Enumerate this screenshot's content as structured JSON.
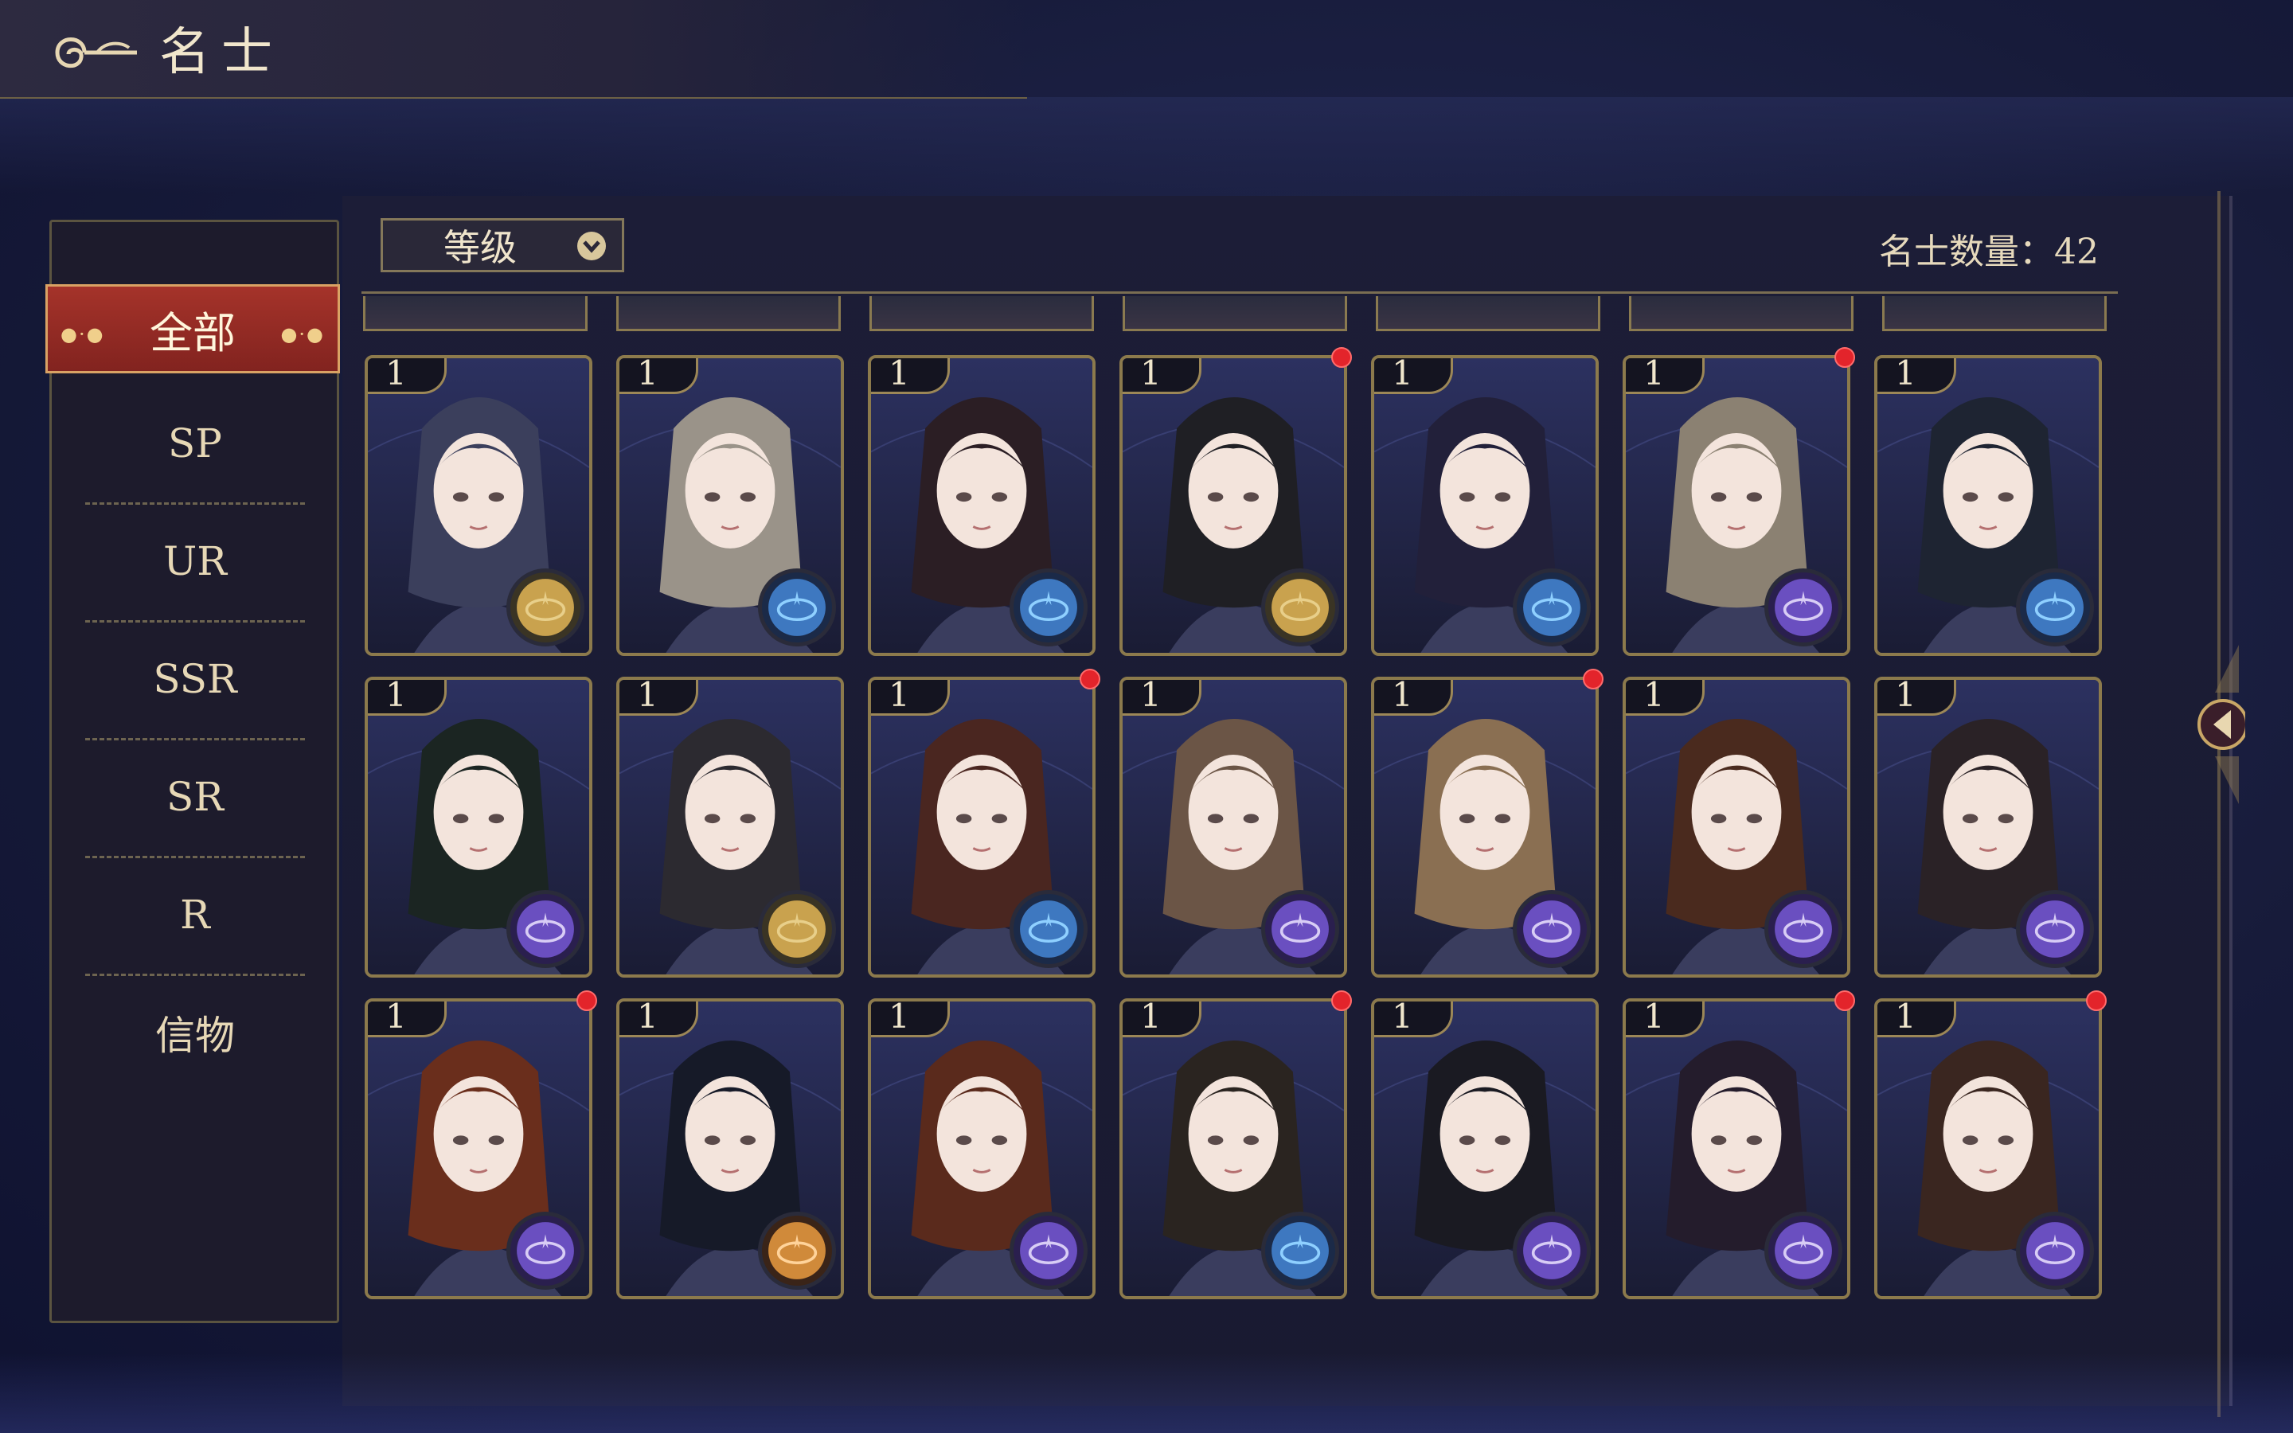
{
  "header": {
    "title": "名士"
  },
  "toolbar": {
    "sort_label": "等级",
    "count_label": "名士数量：42"
  },
  "sidebar": {
    "active": "全部",
    "items": [
      "SP",
      "UR",
      "SSR",
      "SR",
      "R",
      "信物"
    ]
  },
  "colors": {
    "accent_red": "#a5332a",
    "gold_border": "#8c7a4c",
    "notif_red": "#e3242b"
  },
  "cards": [
    {
      "level": "1",
      "hair": "#3b3f5c",
      "emblem": "gold",
      "dot": false
    },
    {
      "level": "1",
      "hair": "#9a9389",
      "emblem": "blue",
      "dot": false
    },
    {
      "level": "1",
      "hair": "#2b1e24",
      "emblem": "blue",
      "dot": false
    },
    {
      "level": "1",
      "hair": "#1f1f24",
      "emblem": "gold",
      "dot": true
    },
    {
      "level": "1",
      "hair": "#22203a",
      "emblem": "blue",
      "dot": false
    },
    {
      "level": "1",
      "hair": "#8b8172",
      "emblem": "purple",
      "dot": true
    },
    {
      "level": "1",
      "hair": "#1e2432",
      "emblem": "blue",
      "dot": false
    },
    {
      "level": "1",
      "hair": "#1b2522",
      "emblem": "purple",
      "dot": false
    },
    {
      "level": "1",
      "hair": "#2c2a30",
      "emblem": "gold",
      "dot": false
    },
    {
      "level": "1",
      "hair": "#4a2620",
      "emblem": "blue",
      "dot": true
    },
    {
      "level": "1",
      "hair": "#6b5546",
      "emblem": "purple",
      "dot": false
    },
    {
      "level": "1",
      "hair": "#8a6f52",
      "emblem": "purple",
      "dot": true
    },
    {
      "level": "1",
      "hair": "#4a2a1e",
      "emblem": "purple",
      "dot": false
    },
    {
      "level": "1",
      "hair": "#2a2226",
      "emblem": "purple",
      "dot": false
    },
    {
      "level": "1",
      "hair": "#6a2e1c",
      "emblem": "purple",
      "dot": true
    },
    {
      "level": "1",
      "hair": "#161a28",
      "emblem": "orange",
      "dot": false
    },
    {
      "level": "1",
      "hair": "#5a2a1c",
      "emblem": "purple",
      "dot": false
    },
    {
      "level": "1",
      "hair": "#2a2420",
      "emblem": "blue",
      "dot": true
    },
    {
      "level": "1",
      "hair": "#1a1a22",
      "emblem": "purple",
      "dot": false
    },
    {
      "level": "1",
      "hair": "#241c2c",
      "emblem": "purple",
      "dot": true
    },
    {
      "level": "1",
      "hair": "#3a2620",
      "emblem": "purple",
      "dot": true
    }
  ]
}
